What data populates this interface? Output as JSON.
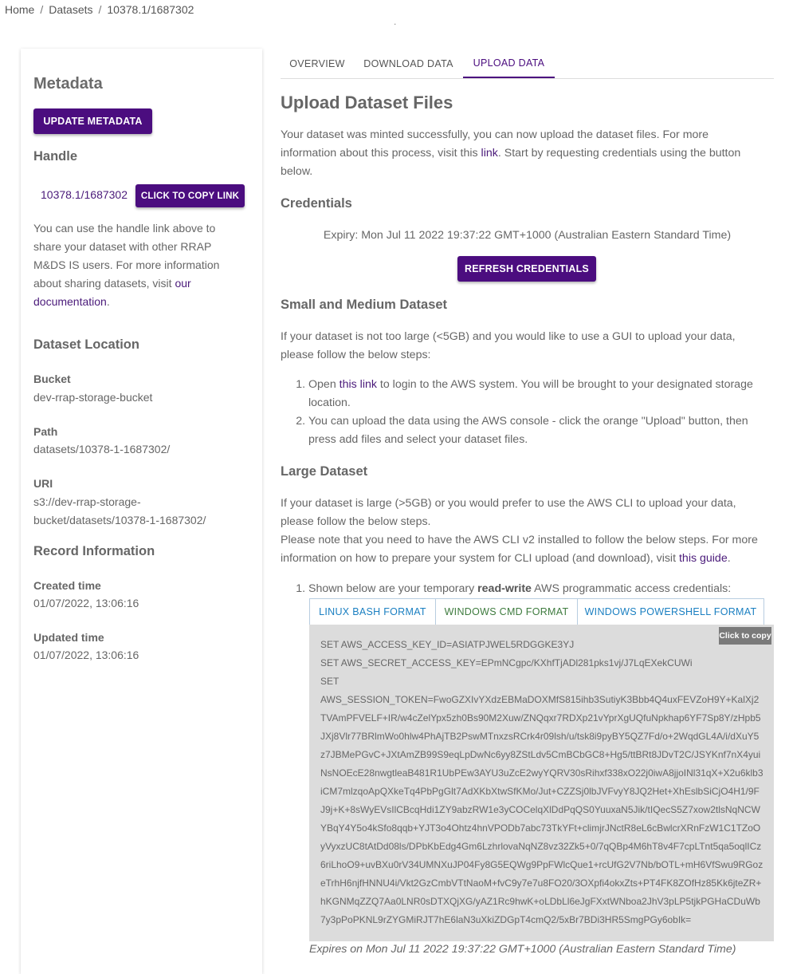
{
  "breadcrumb": {
    "items": [
      "Home",
      "Datasets",
      "10378.1/1687302"
    ],
    "separator": "/"
  },
  "header_dot": ".",
  "sidebar": {
    "title": "Metadata",
    "update_button": "UPDATE METADATA",
    "handle": {
      "heading": "Handle",
      "value": "10378.1/1687302",
      "copy_button": "CLICK TO COPY LINK",
      "description": "You can use the handle link above to share your dataset with other RRAP M&DS IS users. For more information about sharing datasets, visit ",
      "doc_link": "our documentation",
      "end": "."
    },
    "location": {
      "heading": "Dataset Location",
      "bucket_label": "Bucket",
      "bucket_value": "dev-rrap-storage-bucket",
      "path_label": "Path",
      "path_value": "datasets/10378-1-1687302/",
      "uri_label": "URI",
      "uri_value": "s3://dev-rrap-storage-bucket/datasets/10378-1-1687302/"
    },
    "record": {
      "heading": "Record Information",
      "created_label": "Created time",
      "created_value": "01/07/2022, 13:06:16",
      "updated_label": "Updated time",
      "updated_value": "01/07/2022, 13:06:16"
    }
  },
  "tabs": [
    "OVERVIEW",
    "DOWNLOAD DATA",
    "UPLOAD DATA"
  ],
  "active_tab": "UPLOAD DATA",
  "main": {
    "title": "Upload Dataset Files",
    "intro_1": "Your dataset was minted successfully, you can now upload the dataset files. For more information about this process, visit this ",
    "intro_link": "link",
    "intro_2": ". Start by requesting credentials using the button below.",
    "credentials_heading": "Credentials",
    "expiry": "Expiry: Mon Jul 11 2022 19:37:22 GMT+1000 (Australian Eastern Standard Time)",
    "refresh_button": "REFRESH CREDENTIALS",
    "small_heading": "Small and Medium Dataset",
    "small_intro": "If your dataset is not too large (<5GB) and you would like to use a GUI to upload your data, please follow the below steps:",
    "small_step1_a": "Open ",
    "small_step1_link": "this link",
    "small_step1_b": " to login to the AWS system. You will be brought to your designated storage location.",
    "small_step2": "You can upload the data using the AWS console - click the orange \"Upload\" button, then press add files and select your dataset files.",
    "large_heading": "Large Dataset",
    "large_intro": "If your dataset is large (>5GB) or you would prefer to use the AWS CLI to upload your data, please follow the below steps.",
    "large_note_a": "Please note that you need to have the AWS CLI v2 installed to follow the below steps. For more information on how to prepare your system for CLI upload (and download), visit ",
    "large_note_link": "this guide",
    "large_note_end": ".",
    "large_step1_a": "Shown below are your temporary ",
    "large_step1_bold": "read-write",
    "large_step1_b": " AWS programmatic access credentials:",
    "format_tabs": [
      "LINUX BASH FORMAT",
      "WINDOWS CMD FORMAT",
      "WINDOWS POWERSHELL FORMAT"
    ],
    "active_format": "WINDOWS CMD FORMAT",
    "copy_badge": "Click to copy",
    "code": "SET AWS_ACCESS_KEY_ID=ASIATPJWEL5RDGGKE3YJ\nSET AWS_SECRET_ACCESS_KEY=EPmNCgpc/KXhfTjADl281pks1vj/J7LqEXekCUWi\nSET\nAWS_SESSION_TOKEN=FwoGZXIvYXdzEBMaDOXMfS815ihb3SutiyK3Bbb4Q4uxFEVZoH9Y+KalXj2TVAmPFVELF+IR/w4cZelYpx5zh0Bs90M2Xuw/ZNQqxr7RDXp21vYprXgUQfuNpkhap6YF7Sp8Y/zHpb5JXj8Vlr77BRlmWo0hlw4PhAjTB2PswMTnxzsRCrk4r09lsh/u/tsk8i9pyBY5QZ7Fd/o+2WqdGL4A/i/dXuY5z7JBMePGvC+JXtAmZB99S9eqLpDwNc6yy8ZStLdv5CmBCbGC8+Hg5/ttBRt8JDvT2C/JSYKnf7nX4yuiNsNOEcE28nwgtleaB481R1UbPEw3AYU3uZcE2wyYQRV30sRihxf338xO22j0iwA8jjoINl31qX+X2u6klb3iCM7mlzqoApQXkeTq4PbPgGlt7AdXKbXtwSfKMo/Jut+CZZSj0lbJVFvyY8JQ2Het+XhEslbSiCjO4H1/9FJ9j+K+8sWyEVsIlCBcqHdi1ZY9abzRW1e3yCOCelqXlDdPqQS0YuuxaN5Jik/tIQecS5Z7xow2tlsNqNCWYBqY4Y5o4kSfo8qqb+YJT3o4Ohtz4hnVPODb7abc73TkYFt+climjrJNctR8eL6cBwlcrXRnFzW1C1TZoOyVyxzUC8tAtDd08ls/DPbKbEdg4Gm6LzhrlovaNqNZ8vz32Zk5+0/7qQBp4M6hT8v4F7cpLTnt5qa5oqlICz6riLhoO9+uvBXu0rV34UMNXuJP04Fy8G5EQWg9PpFWlcQue1+rcUfG2V7Nb/bOTL+mH6VfSwu9RGozeTrhH6njfHNNU4i/Vkt2GzCmbVTtNaoM+fvC9y7e7u8FO20/3OXpfi4okxZts+PT4FK8ZOfHz85Kk6jteZR+hKGNMqZZQ7Aa0LNR0sDTXQjXG/yAZ1Rc9hwK+oLDbLl6eJgFXxtWNboa2JhV3pLP5tjkPGHaCDuWb7y3pPoPKNL9rZYGMiRJT7hE6laN3uXkiZDGpT4cmQ2/5xBr7BDi3HR5SmgPGy6obIk=",
    "expires": "Expires on Mon Jul 11 2022 19:37:22 GMT+1000 (Australian Eastern Standard Time)"
  },
  "colors": {
    "primary": "#4b0d7f",
    "link": "#4a1a7a",
    "format_tab": "#1a7fc1",
    "format_tab_active": "#3e7b3e",
    "code_bg": "#dcdcdc"
  }
}
